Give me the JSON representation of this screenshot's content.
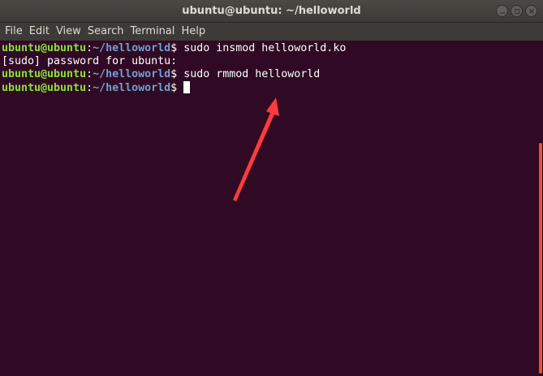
{
  "window": {
    "title": "ubuntu@ubuntu: ~/helloworld"
  },
  "menu": [
    {
      "label": "File"
    },
    {
      "label": "Edit"
    },
    {
      "label": "View"
    },
    {
      "label": "Search"
    },
    {
      "label": "Terminal"
    },
    {
      "label": "Help"
    }
  ],
  "terminal": {
    "lines": [
      {
        "user": "ubuntu@ubuntu",
        "sep": ":",
        "path": "~/helloworld",
        "sym": "$",
        "cmd": " sudo insmod helloworld.ko"
      },
      {
        "text": "[sudo] password for ubuntu:"
      },
      {
        "user": "ubuntu@ubuntu",
        "sep": ":",
        "path": "~/helloworld",
        "sym": "$",
        "cmd": " sudo rmmod helloworld"
      },
      {
        "user": "ubuntu@ubuntu",
        "sep": ":",
        "path": "~/helloworld",
        "sym": "$",
        "cmd": " "
      }
    ]
  },
  "colors": {
    "background": "#300a24",
    "user": "#8ae234",
    "path": "#729fcf",
    "annotation_arrow": "#ff3b3b",
    "scrollbar": "#e95420"
  }
}
